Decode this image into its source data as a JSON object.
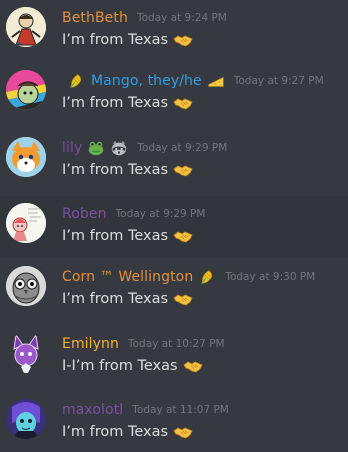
{
  "colors": {
    "background": "#36393f",
    "message_text": "#dcddde",
    "timestamp": "#72767d"
  },
  "messages": [
    {
      "username": "BethBeth",
      "name_color": "#e0913f",
      "timestamp": "Today at 9:24 PM",
      "text": "I’m from Texas",
      "name_prefix_icons": [],
      "name_suffix_icons": [],
      "text_emoji": "handshake-icon"
    },
    {
      "username": "Mango, they/he",
      "name_color": "#2f9ee6",
      "timestamp": "Today at 9:27 PM",
      "text": "I’m from Texas",
      "name_prefix_icons": [
        "corn-icon"
      ],
      "name_suffix_icons": [
        "cheese-icon"
      ],
      "text_emoji": "handshake-icon"
    },
    {
      "username": "lily",
      "name_color": "#7b4fa8",
      "timestamp": "Today at 9:29 PM",
      "text": "I’m from Texas",
      "name_prefix_icons": [],
      "name_suffix_icons": [
        "frog-icon",
        "raccoon-icon"
      ],
      "text_emoji": "handshake-icon"
    },
    {
      "username": "Roben",
      "name_color": "#7b4fa8",
      "timestamp": "Today at 9:29 PM",
      "text": "I’m from Texas",
      "name_prefix_icons": [],
      "name_suffix_icons": [],
      "text_emoji": "handshake-icon"
    },
    {
      "username": "Corn ™ Wellington",
      "name_color": "#e0913f",
      "timestamp": "Today at 9:30 PM",
      "text": "I’m from Texas",
      "name_prefix_icons": [],
      "name_suffix_icons": [
        "corn-icon"
      ],
      "text_emoji": "handshake-icon"
    },
    {
      "username": "Emilynn",
      "name_color": "#f0b232",
      "timestamp": "Today at 10:27 PM",
      "text": "I-I’m from Texas",
      "name_prefix_icons": [],
      "name_suffix_icons": [],
      "text_emoji": "handshake-icon"
    },
    {
      "username": "maxolotl",
      "name_color": "#7b4fa8",
      "timestamp": "Today at 11:07 PM",
      "text": "I’m from Texas",
      "name_prefix_icons": [],
      "name_suffix_icons": [],
      "text_emoji": "handshake-icon"
    }
  ]
}
